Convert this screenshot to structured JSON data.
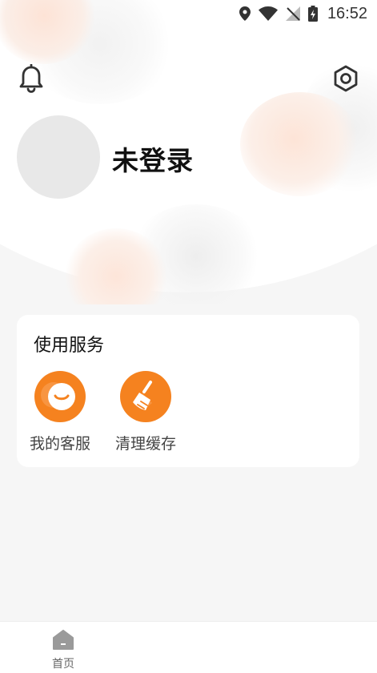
{
  "status_bar": {
    "time": "16:52",
    "icons": [
      "location-icon",
      "wifi-icon",
      "no-signal-icon",
      "battery-charging-icon"
    ]
  },
  "header": {
    "bell_icon": "bell-icon",
    "settings_icon": "settings-hexagon-icon"
  },
  "profile": {
    "username": "未登录"
  },
  "services": {
    "title": "使用服务",
    "items": [
      {
        "label": "我的客服",
        "icon": "smile-icon"
      },
      {
        "label": "清理缓存",
        "icon": "broom-icon"
      }
    ]
  },
  "tabbar": {
    "items": [
      {
        "label": "首页",
        "icon": "home-icon"
      }
    ]
  },
  "colors": {
    "accent": "#f5821f",
    "background": "#f6f6f6",
    "card": "#ffffff",
    "avatar_placeholder": "#e8e8e8"
  }
}
